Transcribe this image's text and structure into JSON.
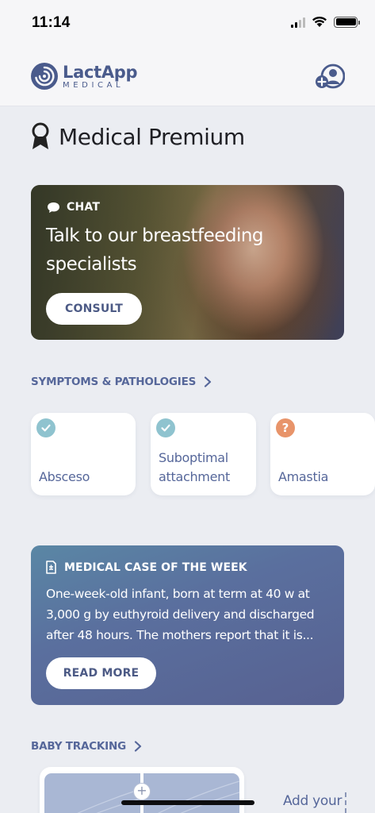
{
  "status_bar": {
    "time": "11:14"
  },
  "header": {
    "logo_name": "LactApp",
    "logo_sub": "MEDICAL",
    "accent_color": "#4a5b8c",
    "profile_icon": "add-user-icon"
  },
  "premium": {
    "title": "Medical Premium",
    "icon": "award-ribbon-icon"
  },
  "chat_card": {
    "label": "CHAT",
    "headline": "Talk to our breastfeeding specialists",
    "button": "CONSULT"
  },
  "symptoms": {
    "section_label": "SYMPTOMS & PATHOLOGIES",
    "items": [
      {
        "label": "Absceso",
        "status": "check-icon"
      },
      {
        "label": "Suboptimal attachment",
        "status": "check-icon"
      },
      {
        "label": "Amastia",
        "status": "question-icon",
        "status_text": "?"
      }
    ]
  },
  "case_of_week": {
    "label": "MEDICAL CASE OF THE WEEK",
    "text": "One-week-old infant, born at term at 40 w at 3,000 g by euthyroid delivery and discharged after 48 hours. The mothers report that it is...",
    "button": "READ MORE"
  },
  "baby_tracking": {
    "section_label": "BABY TRACKING",
    "add_label": "Add your"
  }
}
